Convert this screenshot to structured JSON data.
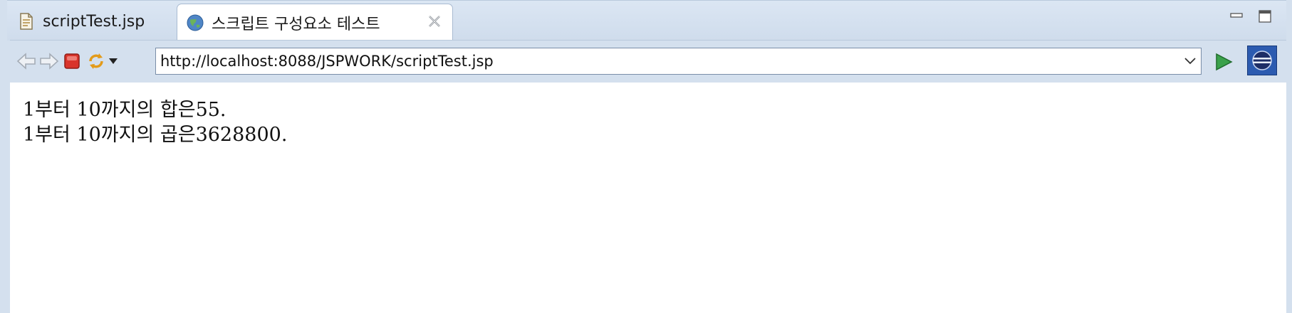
{
  "tabs": [
    {
      "label": "scriptTest.jsp",
      "icon": "jsp-file-icon",
      "active": false
    },
    {
      "label": "스크립트 구성요소 테스트",
      "icon": "globe-icon",
      "active": true
    }
  ],
  "toolbar": {
    "url": "http://localhost:8088/JSPWORK/scriptTest.jsp",
    "icons": [
      "back-icon",
      "forward-icon",
      "stop-icon",
      "refresh-icon",
      "refresh-dropdown-icon",
      "go-icon",
      "eclipse-icon"
    ]
  },
  "page": {
    "lines": [
      "1부터 10까지의 합은55.",
      "1부터 10까지의 곱은3628800."
    ]
  },
  "colors": {
    "accent": "#2c5bb0",
    "stop": "#d9342b",
    "go": "#3aa14b"
  }
}
